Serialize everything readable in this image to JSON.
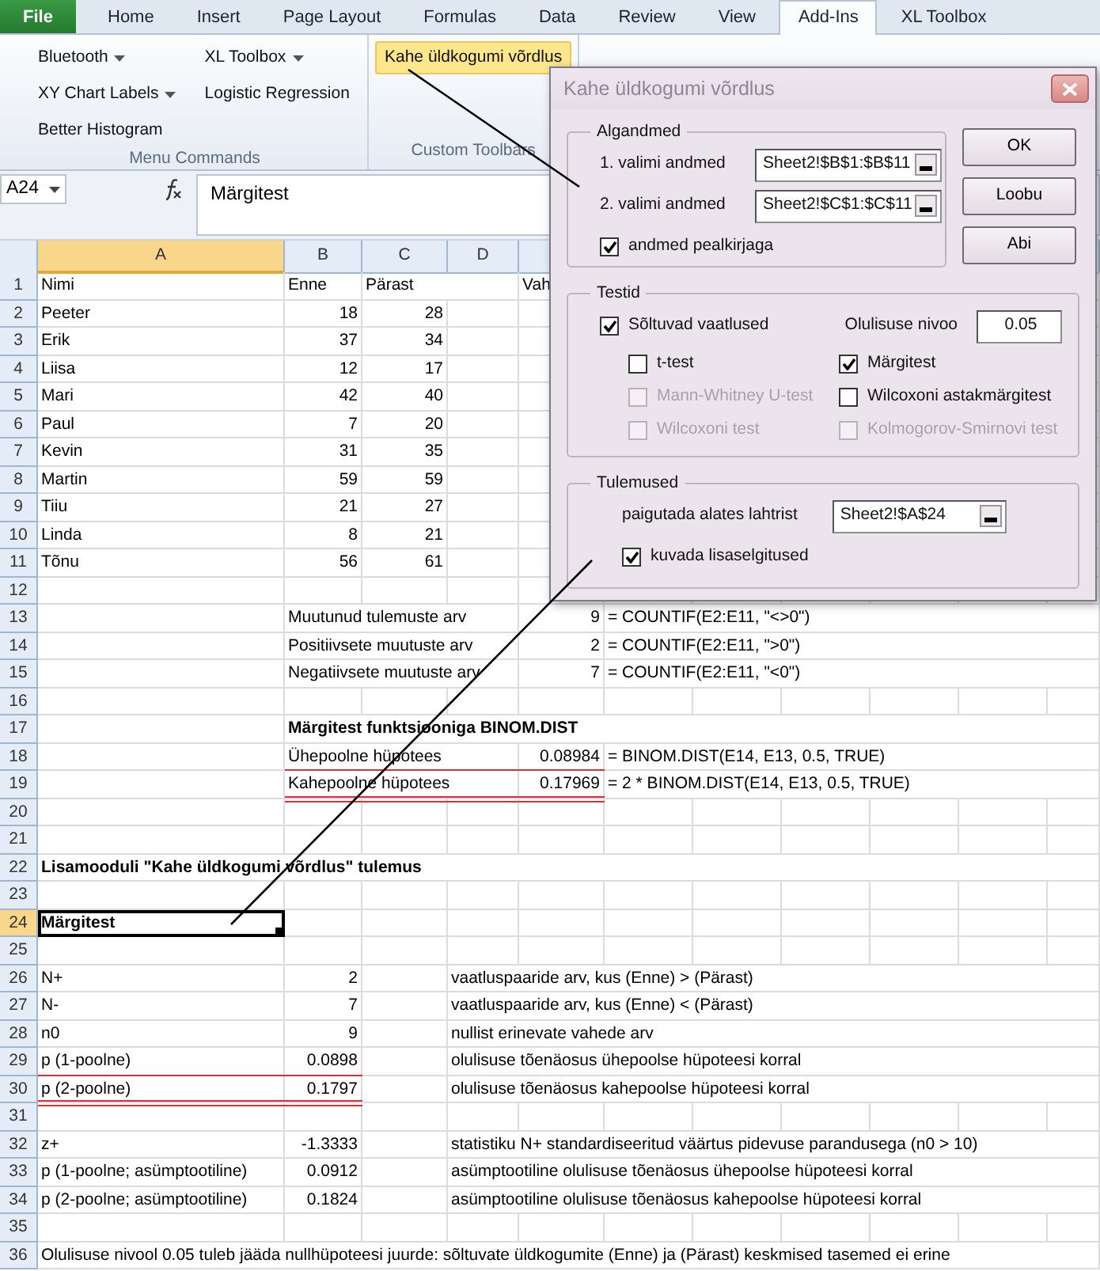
{
  "ribbon": {
    "tabs": [
      {
        "label": "File",
        "kind": "file",
        "selected": false
      },
      {
        "label": "Home",
        "kind": "tab",
        "selected": false
      },
      {
        "label": "Insert",
        "kind": "tab",
        "selected": false
      },
      {
        "label": "Page Layout",
        "kind": "tab",
        "selected": false
      },
      {
        "label": "Formulas",
        "kind": "tab",
        "selected": false
      },
      {
        "label": "Data",
        "kind": "tab",
        "selected": false
      },
      {
        "label": "Review",
        "kind": "tab",
        "selected": false
      },
      {
        "label": "View",
        "kind": "tab",
        "selected": false
      },
      {
        "label": "Add-Ins",
        "kind": "tab",
        "selected": true
      },
      {
        "label": "XL Toolbox",
        "kind": "tab",
        "selected": false
      }
    ],
    "groups": [
      {
        "label": "Menu Commands",
        "columns": [
          [
            {
              "label": "Bluetooth",
              "dropdown": true,
              "highlighted": false
            },
            {
              "label": "XY Chart Labels",
              "dropdown": true,
              "highlighted": false
            },
            {
              "label": "Better Histogram",
              "dropdown": false,
              "highlighted": false
            }
          ],
          [
            {
              "label": "XL Toolbox",
              "dropdown": true,
              "highlighted": false
            },
            {
              "label": "Logistic Regression",
              "dropdown": false,
              "highlighted": false
            }
          ]
        ]
      },
      {
        "label": "Custom Toolbars",
        "columns": [
          [
            {
              "label": "Kahe üldkogumi võrdlus",
              "dropdown": false,
              "highlighted": true
            }
          ]
        ]
      }
    ]
  },
  "formula_bar": {
    "name_box": "A24",
    "content": "Märgitest"
  },
  "sheet": {
    "columns": [
      {
        "label": "A",
        "selected": true
      },
      {
        "label": "B",
        "selected": false
      },
      {
        "label": "C",
        "selected": false
      },
      {
        "label": "D",
        "selected": false
      }
    ],
    "rows": [
      {
        "number": "1",
        "selected": false,
        "underlined": false,
        "cells": {
          "a": {
            "kind": "text",
            "text": "Nimi"
          },
          "b": {
            "kind": "text",
            "text": "Enne"
          },
          "c": {
            "kind": "text",
            "text": "Pärast"
          },
          "e": {
            "kind": "text",
            "text": "Vah"
          }
        }
      },
      {
        "number": "2",
        "selected": false,
        "underlined": false,
        "cells": {
          "a": {
            "kind": "text",
            "text": "Peeter"
          },
          "b": {
            "kind": "number",
            "text": "18"
          },
          "c": {
            "kind": "number",
            "text": "28"
          }
        }
      },
      {
        "number": "3",
        "selected": false,
        "underlined": false,
        "cells": {
          "a": {
            "kind": "text",
            "text": "Erik"
          },
          "b": {
            "kind": "number",
            "text": "37"
          },
          "c": {
            "kind": "number",
            "text": "34"
          }
        }
      },
      {
        "number": "4",
        "selected": false,
        "underlined": false,
        "cells": {
          "a": {
            "kind": "text",
            "text": "Liisa"
          },
          "b": {
            "kind": "number",
            "text": "12"
          },
          "c": {
            "kind": "number",
            "text": "17"
          }
        }
      },
      {
        "number": "5",
        "selected": false,
        "underlined": false,
        "cells": {
          "a": {
            "kind": "text",
            "text": "Mari"
          },
          "b": {
            "kind": "number",
            "text": "42"
          },
          "c": {
            "kind": "number",
            "text": "40"
          }
        }
      },
      {
        "number": "6",
        "selected": false,
        "underlined": false,
        "cells": {
          "a": {
            "kind": "text",
            "text": "Paul"
          },
          "b": {
            "kind": "number",
            "text": "7"
          },
          "c": {
            "kind": "number",
            "text": "20"
          }
        }
      },
      {
        "number": "7",
        "selected": false,
        "underlined": false,
        "cells": {
          "a": {
            "kind": "text",
            "text": "Kevin"
          },
          "b": {
            "kind": "number",
            "text": "31"
          },
          "c": {
            "kind": "number",
            "text": "35"
          }
        }
      },
      {
        "number": "8",
        "selected": false,
        "underlined": false,
        "cells": {
          "a": {
            "kind": "text",
            "text": "Martin"
          },
          "b": {
            "kind": "number",
            "text": "59"
          },
          "c": {
            "kind": "number",
            "text": "59"
          }
        }
      },
      {
        "number": "9",
        "selected": false,
        "underlined": false,
        "cells": {
          "a": {
            "kind": "text",
            "text": "Tiiu"
          },
          "b": {
            "kind": "number",
            "text": "21"
          },
          "c": {
            "kind": "number",
            "text": "27"
          }
        }
      },
      {
        "number": "10",
        "selected": false,
        "underlined": false,
        "cells": {
          "a": {
            "kind": "text",
            "text": "Linda"
          },
          "b": {
            "kind": "number",
            "text": "8"
          },
          "c": {
            "kind": "number",
            "text": "21"
          }
        }
      },
      {
        "number": "11",
        "selected": false,
        "underlined": false,
        "cells": {
          "a": {
            "kind": "text",
            "text": "Tõnu"
          },
          "b": {
            "kind": "number",
            "text": "56"
          },
          "c": {
            "kind": "number",
            "text": "61"
          }
        }
      },
      {
        "number": "12",
        "selected": false,
        "underlined": false,
        "cells": {}
      },
      {
        "number": "13",
        "selected": false,
        "underlined": false,
        "cells": {
          "b": {
            "kind": "text",
            "text": "Muutunud tulemuste arv"
          },
          "e": {
            "kind": "number",
            "text": "9"
          },
          "f": {
            "kind": "text",
            "text": "= COUNTIF(E2:E11, \"<>0\")"
          }
        }
      },
      {
        "number": "14",
        "selected": false,
        "underlined": false,
        "cells": {
          "b": {
            "kind": "text",
            "text": "Positiivsete muutuste arv"
          },
          "e": {
            "kind": "number",
            "text": "2"
          },
          "f": {
            "kind": "text",
            "text": "= COUNTIF(E2:E11, \">0\")"
          }
        }
      },
      {
        "number": "15",
        "selected": false,
        "underlined": false,
        "cells": {
          "b": {
            "kind": "text",
            "text": "Negatiivsete muutuste arv"
          },
          "e": {
            "kind": "number",
            "text": "7"
          },
          "f": {
            "kind": "text",
            "text": "= COUNTIF(E2:E11, \"<0\")"
          }
        }
      },
      {
        "number": "16",
        "selected": false,
        "underlined": false,
        "cells": {}
      },
      {
        "number": "17",
        "selected": false,
        "underlined": false,
        "cells": {
          "b": {
            "kind": "heading",
            "text": "Märgitest funktsiooniga BINOM.DIST"
          }
        }
      },
      {
        "number": "18",
        "selected": false,
        "underlined": true,
        "double_underline": false,
        "cells": {
          "b": {
            "kind": "text",
            "text": "Ühepoolne hüpotees"
          },
          "e": {
            "kind": "number",
            "text": "0.08984"
          },
          "f": {
            "kind": "text",
            "text": "= BINOM.DIST(E14, E13, 0.5, TRUE)"
          }
        }
      },
      {
        "number": "19",
        "selected": false,
        "underlined": true,
        "double_underline": true,
        "cells": {
          "b": {
            "kind": "text",
            "text": "Kahepoolne hüpotees"
          },
          "e": {
            "kind": "number",
            "text": "0.17969"
          },
          "f": {
            "kind": "text",
            "text": "= 2 * BINOM.DIST(E14, E13, 0.5, TRUE)"
          }
        }
      },
      {
        "number": "20",
        "selected": false,
        "underlined": false,
        "cells": {}
      },
      {
        "number": "21",
        "selected": false,
        "underlined": false,
        "cells": {}
      },
      {
        "number": "22",
        "selected": false,
        "underlined": false,
        "cells": {
          "a": {
            "kind": "heading",
            "text": "Lisamooduli \"Kahe üldkogumi võrdlus\" tulemus"
          }
        }
      },
      {
        "number": "23",
        "selected": false,
        "underlined": false,
        "cells": {}
      },
      {
        "number": "24",
        "selected": true,
        "underlined": false,
        "cells": {
          "a": {
            "kind": "heading",
            "text": "Märgitest"
          }
        }
      },
      {
        "number": "25",
        "selected": false,
        "underlined": false,
        "cells": {}
      },
      {
        "number": "26",
        "selected": false,
        "underlined": false,
        "cells": {
          "a": {
            "kind": "text",
            "text": "N+"
          },
          "b": {
            "kind": "number",
            "text": "2"
          },
          "d": {
            "kind": "text",
            "text": "vaatluspaaride arv, kus (Enne) > (Pärast)"
          }
        }
      },
      {
        "number": "27",
        "selected": false,
        "underlined": false,
        "cells": {
          "a": {
            "kind": "text",
            "text": "N-"
          },
          "b": {
            "kind": "number",
            "text": "7"
          },
          "d": {
            "kind": "text",
            "text": "vaatluspaaride arv, kus (Enne) < (Pärast)"
          }
        }
      },
      {
        "number": "28",
        "selected": false,
        "underlined": false,
        "cells": {
          "a": {
            "kind": "text",
            "text": "n0"
          },
          "b": {
            "kind": "number",
            "text": "9"
          },
          "d": {
            "kind": "text",
            "text": "nullist erinevate vahede arv"
          }
        }
      },
      {
        "number": "29",
        "selected": false,
        "underlined": true,
        "double_underline": false,
        "cells": {
          "a": {
            "kind": "text",
            "text": "p (1-poolne)"
          },
          "b": {
            "kind": "number",
            "text": "0.0898"
          },
          "d": {
            "kind": "text",
            "text": "olulisuse tõenäosus ühepoolse hüpoteesi korral"
          }
        }
      },
      {
        "number": "30",
        "selected": false,
        "underlined": true,
        "double_underline": true,
        "cells": {
          "a": {
            "kind": "text",
            "text": "p (2-poolne)"
          },
          "b": {
            "kind": "number",
            "text": "0.1797"
          },
          "d": {
            "kind": "text",
            "text": "olulisuse tõenäosus kahepoolse hüpoteesi korral"
          }
        }
      },
      {
        "number": "31",
        "selected": false,
        "underlined": false,
        "cells": {}
      },
      {
        "number": "32",
        "selected": false,
        "underlined": false,
        "cells": {
          "a": {
            "kind": "text",
            "text": "z+"
          },
          "b": {
            "kind": "number",
            "text": "-1.3333"
          },
          "d": {
            "kind": "text",
            "text": "statistiku N+ standardiseeritud väärtus pidevuse parandusega (n0 > 10)"
          }
        }
      },
      {
        "number": "33",
        "selected": false,
        "underlined": false,
        "cells": {
          "a": {
            "kind": "text",
            "text": "p (1-poolne; asümptootiline)"
          },
          "b": {
            "kind": "number",
            "text": "0.0912"
          },
          "d": {
            "kind": "text",
            "text": "asümptootiline olulisuse tõenäosus ühepoolse hüpoteesi korral"
          }
        }
      },
      {
        "number": "34",
        "selected": false,
        "underlined": false,
        "cells": {
          "a": {
            "kind": "text",
            "text": "p (2-poolne; asümptootiline)"
          },
          "b": {
            "kind": "number",
            "text": "0.1824"
          },
          "d": {
            "kind": "text",
            "text": "asümptootiline olulisuse tõenäosus kahepoolse hüpoteesi korral"
          }
        }
      },
      {
        "number": "35",
        "selected": false,
        "underlined": false,
        "cells": {}
      },
      {
        "number": "36",
        "selected": false,
        "underlined": false,
        "cells": {
          "a": {
            "kind": "text",
            "text": "Olulisuse nivool 0.05 tuleb jääda nullhüpoteesi juurde: sõltuvate üldkogumite (Enne) ja (Pärast) keskmised tasemed ei erine"
          }
        }
      }
    ]
  },
  "dialog": {
    "title": "Kahe üldkogumi võrdlus",
    "groups": [
      {
        "title": "Algandmed",
        "rows": [
          [
            {
              "kind": "field",
              "label": "1. valimi andmed",
              "value": "Sheet2!$B$1:$B$11",
              "picker": true
            }
          ],
          [
            {
              "kind": "field",
              "label": "2. valimi andmed",
              "value": "Sheet2!$C$1:$C$11",
              "picker": true
            }
          ],
          [
            {
              "kind": "checkbox",
              "label": "andmed pealkirjaga",
              "checked": true,
              "disabled": false
            }
          ]
        ]
      },
      {
        "title": "Testid",
        "rows": [
          [
            {
              "kind": "checkbox",
              "label": "Sõltuvad vaatlused",
              "checked": true,
              "disabled": false
            },
            {
              "kind": "field",
              "label": "Olulisuse nivoo",
              "value": "0.05",
              "picker": false
            }
          ],
          [
            {
              "kind": "checkbox",
              "label": "t-test",
              "checked": false,
              "disabled": false
            },
            {
              "kind": "checkbox",
              "label": "Märgitest",
              "checked": true,
              "disabled": false
            }
          ],
          [
            {
              "kind": "checkbox",
              "label": "Mann-Whitney U-test",
              "checked": false,
              "disabled": true
            },
            {
              "kind": "checkbox",
              "label": "Wilcoxoni astakmärgitest",
              "checked": false,
              "disabled": false
            }
          ],
          [
            {
              "kind": "checkbox",
              "label": "Wilcoxoni test",
              "checked": false,
              "disabled": true
            },
            {
              "kind": "checkbox",
              "label": "Kolmogorov-Smirnovi test",
              "checked": false,
              "disabled": true
            }
          ]
        ]
      },
      {
        "title": "Tulemused",
        "rows": [
          [
            {
              "kind": "field",
              "label": "paigutada alates lahtrist",
              "value": "Sheet2!$A$24",
              "picker": true
            }
          ],
          [
            {
              "kind": "checkbox",
              "label": "kuvada lisaselgitused",
              "checked": true,
              "disabled": false
            }
          ]
        ]
      }
    ],
    "buttons": [
      "OK",
      "Loobu",
      "Abi"
    ]
  }
}
